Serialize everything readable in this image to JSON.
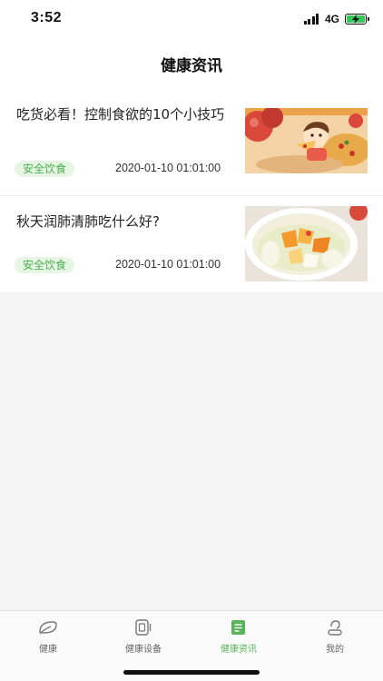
{
  "status_bar": {
    "time": "3:52",
    "network": "4G",
    "battery_color": "#35c759"
  },
  "header": {
    "title": "健康资讯"
  },
  "articles": [
    {
      "title": "吃货必看！控制食欲的10个小技巧",
      "tag": "安全饮食",
      "date": "2020-01-10 01:01:00",
      "thumbnail_icon": "cartoon-eating-pizza-image"
    },
    {
      "title": "秋天润肺清肺吃什么好?",
      "tag": "安全饮食",
      "date": "2020-01-10 01:01:00",
      "thumbnail_icon": "fruit-soup-bowl-image"
    }
  ],
  "tab_bar": {
    "items": [
      {
        "label": "健康",
        "icon": "leaf-icon",
        "active": false
      },
      {
        "label": "健康设备",
        "icon": "device-icon",
        "active": false
      },
      {
        "label": "健康资讯",
        "icon": "news-icon",
        "active": true
      },
      {
        "label": "我的",
        "icon": "profile-icon",
        "active": false
      }
    ],
    "active_color": "#5ab35a",
    "inactive_color": "#666666"
  }
}
